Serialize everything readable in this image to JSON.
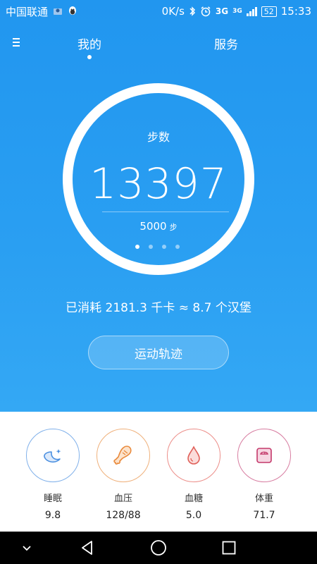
{
  "status": {
    "carrier": "中国联通",
    "speed": "0K/s",
    "network": "3G",
    "network2": "3G",
    "battery": "52",
    "time": "15:33"
  },
  "tabs": {
    "mine": "我的",
    "service": "服务"
  },
  "steps": {
    "label": "步数",
    "value": "13397",
    "goal_value": "5000",
    "goal_unit": "步"
  },
  "calories_text": "已消耗 2181.3 千卡 ≈ 8.7 个汉堡",
  "track_button": "运动轨迹",
  "metrics": [
    {
      "label": "睡眠",
      "value": "9.8",
      "icon": "moon-icon",
      "color": "#4a8fe0"
    },
    {
      "label": "血压",
      "value": "128/88",
      "icon": "drumstick-icon",
      "color": "#e98a3c"
    },
    {
      "label": "血糖",
      "value": "5.0",
      "icon": "drop-icon",
      "color": "#e0615a"
    },
    {
      "label": "体重",
      "value": "71.7",
      "icon": "scale-icon",
      "color": "#c4386a"
    }
  ],
  "colors": {
    "primary": "#2196ef",
    "white": "#ffffff"
  }
}
